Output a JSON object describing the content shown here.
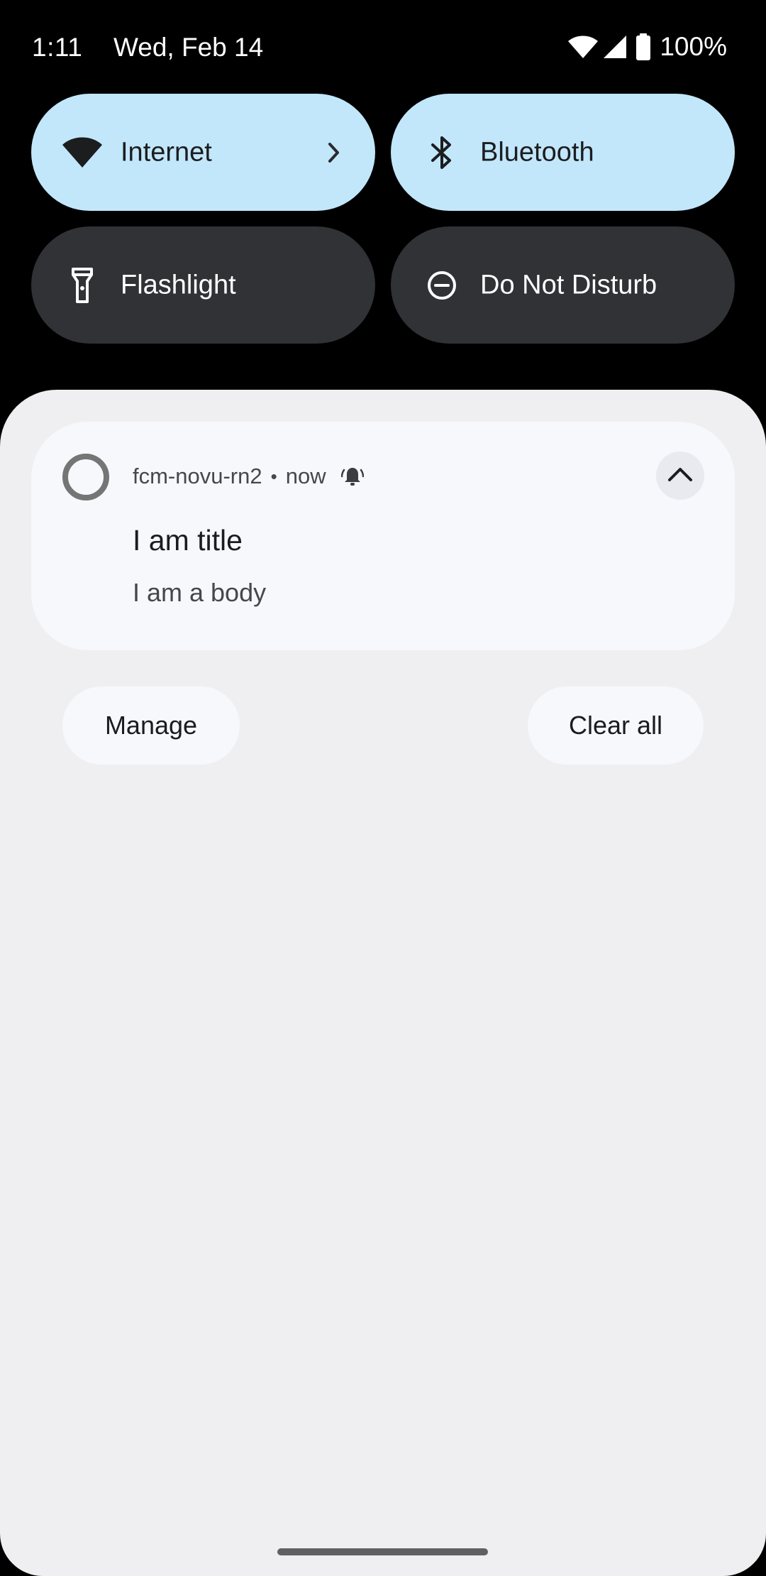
{
  "status_bar": {
    "time": "1:11",
    "date": "Wed, Feb 14",
    "battery_percent": "100%",
    "icons": [
      "wifi-icon",
      "cell-signal-icon",
      "battery-icon"
    ]
  },
  "quick_settings": {
    "tiles": [
      {
        "label": "Internet",
        "icon": "wifi-icon",
        "state": "on",
        "has_chevron": true
      },
      {
        "label": "Bluetooth",
        "icon": "bluetooth-icon",
        "state": "on"
      },
      {
        "label": "Flashlight",
        "icon": "flashlight-icon",
        "state": "off"
      },
      {
        "label": "Do Not Disturb",
        "icon": "do-not-disturb-icon",
        "state": "off"
      }
    ]
  },
  "notification": {
    "app_name": "fcm-novu-rn2",
    "separator": "•",
    "time": "now",
    "alert_icon": "bell-ringing-icon",
    "title": "I am title",
    "body": "I am a body"
  },
  "actions": {
    "manage_label": "Manage",
    "clear_all_label": "Clear all"
  },
  "colors": {
    "active_tile": "#c2e7fb",
    "inactive_tile": "#303236",
    "shade_background": "#efeff1",
    "card_background": "#f6f8fc"
  }
}
